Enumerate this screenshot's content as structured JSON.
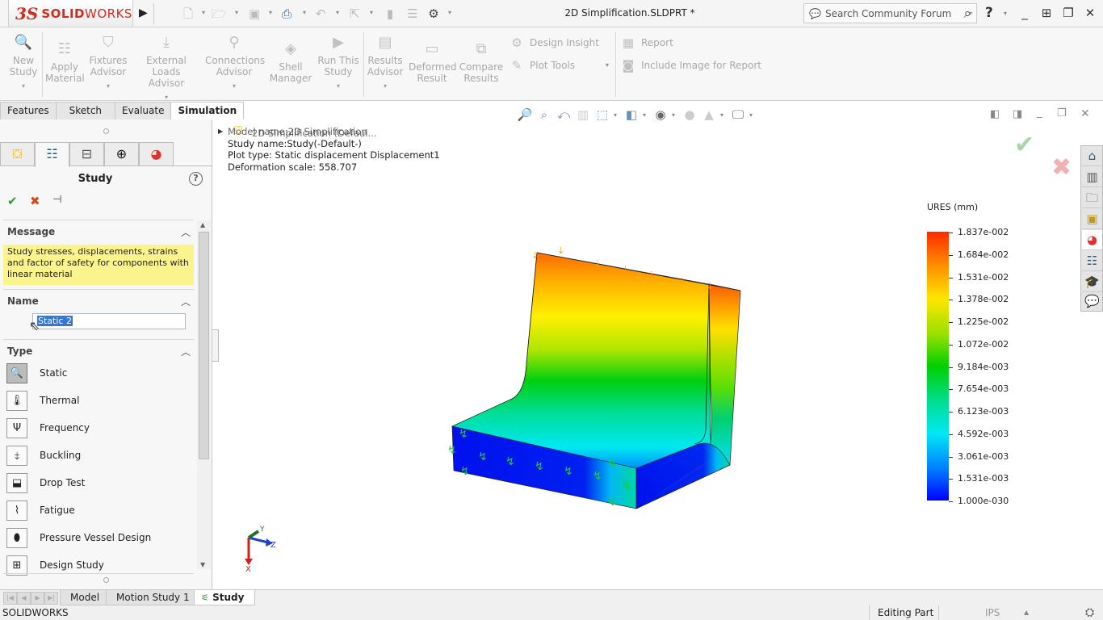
{
  "titlebar": {
    "logo_ds": "3S",
    "logo_text_bold": "SOLID",
    "logo_text_light": "WORKS",
    "document_title": "2D Simplification.SLDPRT *",
    "search_placeholder": "Search Community Forum",
    "help_label": "?",
    "quick_icons": [
      "new-document-icon",
      "open-folder-icon",
      "save-icon",
      "print-icon",
      "undo-icon",
      "select-arrow-icon",
      "rebuild-icon",
      "file-properties-icon",
      "options-gear-icon"
    ]
  },
  "ribbon": {
    "buttons": [
      {
        "id": "new-study",
        "line1": "New",
        "line2": "Study",
        "icon": "magnifier-star-icon"
      },
      {
        "id": "apply-material",
        "line1": "Apply",
        "line2": "Material",
        "icon": "material-list-icon"
      },
      {
        "id": "fixtures-advisor",
        "line1": "Fixtures",
        "line2": "Advisor",
        "icon": "fixture-icon"
      },
      {
        "id": "external-loads-advisor",
        "line1": "External Loads",
        "line2": "Advisor",
        "icon": "loads-icon"
      },
      {
        "id": "connections-advisor",
        "line1": "Connections",
        "line2": "Advisor",
        "icon": "bolt-icon"
      },
      {
        "id": "shell-manager",
        "line1": "Shell",
        "line2": "Manager",
        "icon": "shell-icon"
      },
      {
        "id": "run-this-study",
        "line1": "Run This",
        "line2": "Study",
        "icon": "run-study-icon"
      },
      {
        "id": "results-advisor",
        "line1": "Results",
        "line2": "Advisor",
        "icon": "results-advisor-icon"
      },
      {
        "id": "deformed-result",
        "line1": "Deformed",
        "line2": "Result",
        "icon": "deformed-icon"
      },
      {
        "id": "compare-results",
        "line1": "Compare",
        "line2": "Results",
        "icon": "compare-icon"
      }
    ],
    "small": {
      "design_insight": "Design Insight",
      "plot_tools": "Plot Tools",
      "report": "Report",
      "include_image": "Include Image for Report"
    }
  },
  "command_tabs": [
    "Features",
    "Sketch",
    "Evaluate",
    "Simulation"
  ],
  "active_command_tab": "Simulation",
  "property_manager": {
    "title": "Study",
    "help": "?",
    "message_header": "Message",
    "message_text": "Study stresses, displacements, strains and factor of safety  for components with linear material",
    "name_header": "Name",
    "name_value": "Static 2",
    "type_header": "Type",
    "types": [
      {
        "label": "Static",
        "selected": true
      },
      {
        "label": "Thermal",
        "selected": false
      },
      {
        "label": "Frequency",
        "selected": false
      },
      {
        "label": "Buckling",
        "selected": false
      },
      {
        "label": "Drop Test",
        "selected": false
      },
      {
        "label": "Fatigue",
        "selected": false
      },
      {
        "label": "Pressure Vessel Design",
        "selected": false
      },
      {
        "label": "Design Study",
        "selected": false
      }
    ]
  },
  "graphics": {
    "tree_part": "2D Simplification  (Defaul...",
    "plot_info": [
      "Model name:2D Simplification",
      "Study name:Study(-Default-)",
      "Plot type: Static displacement Displacement1",
      "Deformation scale: 558.707"
    ],
    "legend_title": "URES (mm)",
    "legend_labels": [
      "1.837e-002",
      "1.684e-002",
      "1.531e-002",
      "1.378e-002",
      "1.225e-002",
      "1.072e-002",
      "9.184e-003",
      "7.654e-003",
      "6.123e-003",
      "4.592e-003",
      "3.061e-003",
      "1.531e-003",
      "1.000e-030"
    ],
    "triad": {
      "x": "X",
      "y": "Y",
      "z": "Z"
    }
  },
  "bottom_tabs": [
    "Model",
    "Motion Study 1",
    "Study"
  ],
  "active_bottom_tab": "Study",
  "status": {
    "app": "SOLIDWORKS",
    "mode": "Editing Part",
    "units": "IPS"
  },
  "colors": {
    "brand_red": "#d52b1e",
    "message_yellow": "#fbf38c",
    "selection_blue": "#3478d0"
  }
}
